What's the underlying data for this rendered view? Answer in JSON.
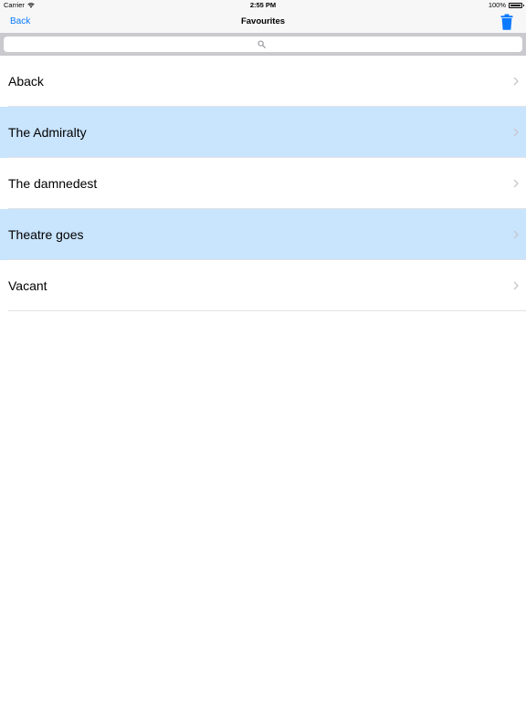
{
  "status_bar": {
    "carrier": "Carrier",
    "time": "2:55 PM",
    "battery": "100%",
    "battery_level": 1.0
  },
  "nav": {
    "back_label": "Back",
    "title": "Favourites",
    "trash_icon": "trash-icon"
  },
  "search": {
    "placeholder": "",
    "value": ""
  },
  "colors": {
    "accent": "#0a7aff",
    "highlight": "#c9e4fd",
    "search_bar_bg": "#c9c9ce"
  },
  "list": {
    "items": [
      {
        "label": "Aback",
        "highlighted": false
      },
      {
        "label": "The Admiralty",
        "highlighted": true
      },
      {
        "label": "The damnedest",
        "highlighted": false
      },
      {
        "label": "Theatre goes",
        "highlighted": true
      },
      {
        "label": "Vacant",
        "highlighted": false
      }
    ]
  }
}
